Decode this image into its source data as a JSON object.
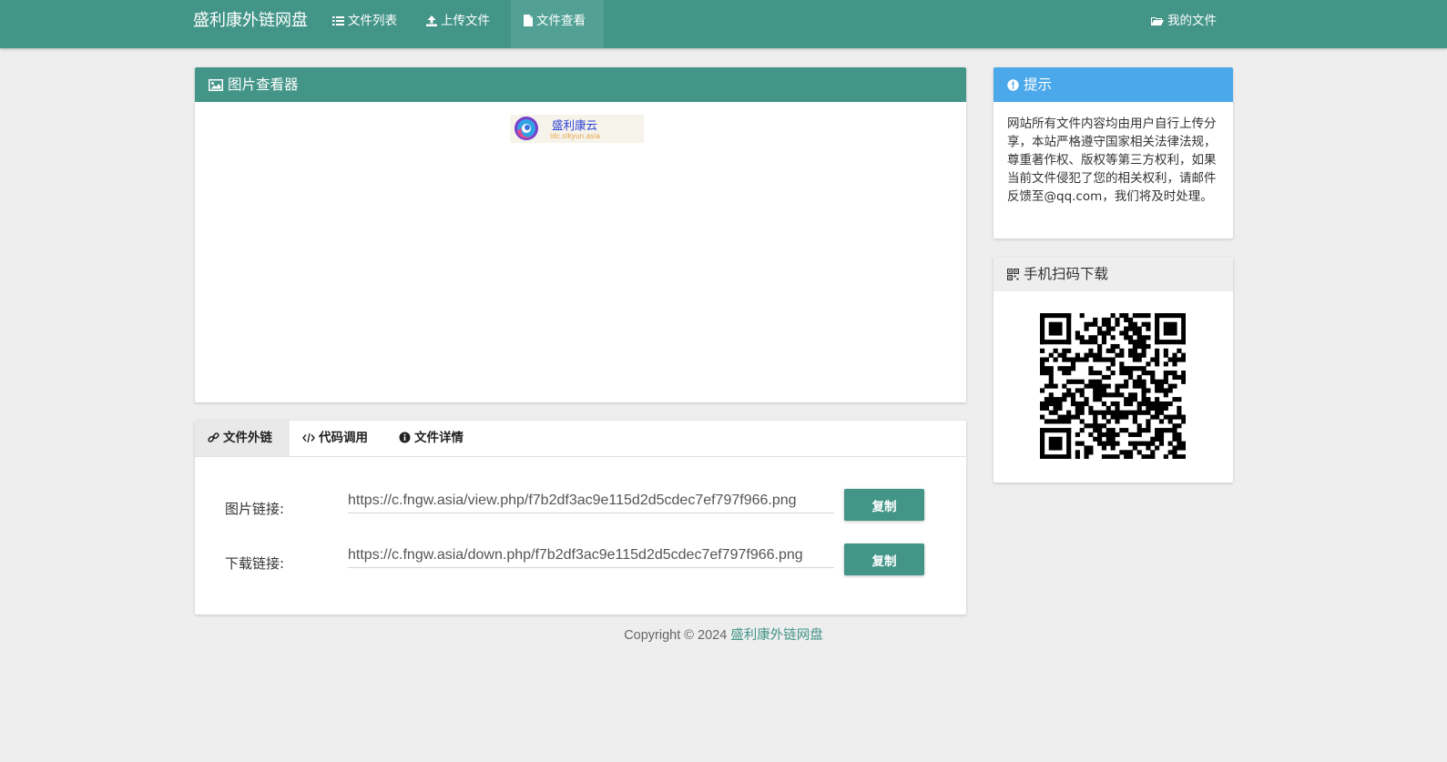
{
  "navbar": {
    "brand": "盛利康外链网盘",
    "items": [
      {
        "label": "文件列表",
        "icon": "list-icon"
      },
      {
        "label": "上传文件",
        "icon": "upload-icon"
      },
      {
        "label": "文件查看",
        "icon": "file-icon",
        "active": true
      }
    ],
    "my_files": {
      "label": "我的文件",
      "icon": "folder-open-icon"
    }
  },
  "viewer": {
    "title": "图片查看器",
    "icon": "image-icon",
    "image": {
      "logo_text": "盛利康云",
      "logo_sub": "idc.slkyun.asia"
    }
  },
  "links_panel": {
    "tabs": [
      {
        "label": "文件外链",
        "icon": "link-icon",
        "active": true
      },
      {
        "label": "代码调用",
        "icon": "code-icon"
      },
      {
        "label": "文件详情",
        "icon": "info-circle-icon"
      }
    ],
    "rows": [
      {
        "label": "图片链接:",
        "value": "https://c.fngw.asia/view.php/f7b2df3ac9e115d2d5cdec7ef797f966.png",
        "button": "复制"
      },
      {
        "label": "下载链接:",
        "value": "https://c.fngw.asia/down.php/f7b2df3ac9e115d2d5cdec7ef797f966.png",
        "button": "复制"
      }
    ]
  },
  "notice": {
    "title": "提示",
    "icon": "exclamation-circle-icon",
    "text": "网站所有文件内容均由用户自行上传分享，本站严格遵守国家相关法律法规，尊重著作权、版权等第三方权利，如果当前文件侵犯了您的相关权利，请邮件反馈至@qq.com，我们将及时处理。"
  },
  "qr_panel": {
    "title": "手机扫码下载",
    "icon": "qrcode-icon"
  },
  "footer": {
    "copyright": "Copyright © 2024",
    "site_name": "盛利康外链网盘"
  },
  "colors": {
    "primary": "#439588",
    "info": "#4ba8ea",
    "background": "#eeeeee"
  }
}
